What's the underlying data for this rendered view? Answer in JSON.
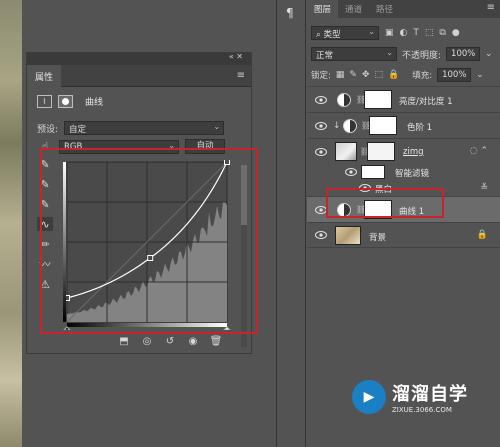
{
  "properties_panel": {
    "tab_label": "属性",
    "menu_icon": "menu-icon",
    "header_title": "曲线",
    "preset_label": "预设:",
    "preset_value": "自定",
    "channel_value": "RGB",
    "auto_button": "自动"
  },
  "curve": {
    "control_points": [
      [
        0.0,
        0.15
      ],
      [
        0.52,
        0.4
      ],
      [
        1.0,
        1.0
      ]
    ],
    "histogram_fill": "#8a8a8a",
    "curve_color": "#ffffff"
  },
  "tool_rail": {
    "icon": "paragraph-icon",
    "glyph": "¶"
  },
  "layers_panel": {
    "tabs": [
      "图层",
      "通道",
      "路径"
    ],
    "active_tab": "图层",
    "filter_label": "类型",
    "blend_mode": "正常",
    "opacity_label": "不透明度:",
    "opacity_value": "100%",
    "lock_label": "锁定:",
    "fill_label": "填充:",
    "fill_value": "100%",
    "layers": [
      {
        "name": "亮度/对比度 1",
        "kind": "adjustment"
      },
      {
        "name": "色阶 1",
        "kind": "adjustment"
      },
      {
        "name": "zimg",
        "kind": "smart"
      },
      {
        "name": "智能滤镜",
        "kind": "filter-group"
      },
      {
        "name": "黑白",
        "kind": "filter"
      },
      {
        "name": "曲线 1",
        "kind": "adjustment",
        "selected": true
      },
      {
        "name": "背景",
        "kind": "background"
      }
    ]
  },
  "watermark": {
    "brand": "溜溜自学",
    "url": "ZIXUE.3066.COM"
  },
  "colors": {
    "panel_bg": "#535353",
    "highlight_red": "#c8242b",
    "selected_layer": "#6b6b6b"
  }
}
